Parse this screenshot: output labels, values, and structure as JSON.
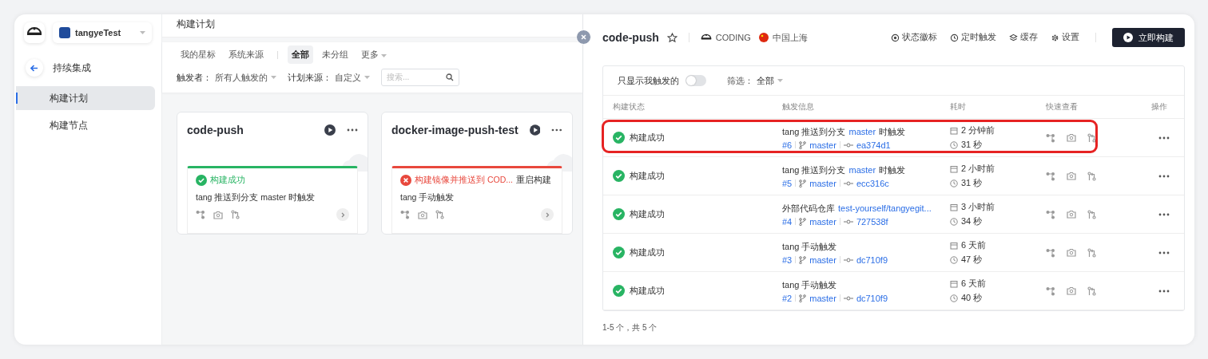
{
  "sidebar": {
    "project": "tangyeTest",
    "back_label": "持续集成",
    "items": [
      {
        "label": "构建计划",
        "selected": true
      },
      {
        "label": "构建节点",
        "selected": false
      }
    ]
  },
  "plans": {
    "title": "构建计划",
    "tabs": [
      {
        "label": "我的星标",
        "selected": false
      },
      {
        "label": "系统来源",
        "selected": false
      },
      {
        "label": "全部",
        "selected": true
      },
      {
        "label": "未分组",
        "selected": false
      },
      {
        "label": "更多",
        "selected": false,
        "kind": "dropdown"
      }
    ],
    "filters": [
      {
        "label": "触发者：",
        "value": "所有人触发的"
      },
      {
        "label": "计划来源：",
        "value": "自定义"
      }
    ],
    "search": {
      "placeholder": "搜索..."
    },
    "cards": [
      {
        "name": "code-push",
        "kind": "success",
        "status_text": "构建成功",
        "trigger": "tang 推送到分支 master 时触发"
      },
      {
        "name": "docker-image-push-test",
        "kind": "failed",
        "status_text": "构建镜像并推送到 COD...",
        "action": "重启构建",
        "trigger": "tang 手动触发"
      }
    ]
  },
  "detail": {
    "title": "code-push",
    "starred": false,
    "org": "CODING",
    "region": "中国上海",
    "actions": [
      "状态徽标",
      "定时触发",
      "缓存",
      "设置"
    ],
    "primary": "立即构建",
    "toggle": {
      "label": "只显示我触发的",
      "on": false
    },
    "filter": {
      "label": "筛选：",
      "value": "全部"
    },
    "columns": [
      "构建状态",
      "触发信息",
      "耗时",
      "快速查看",
      "操作"
    ],
    "rows": [
      {
        "kind": "success",
        "status_text": "构建成功",
        "trigger": {
          "before": "tang 推送到分支 ",
          "link": "master",
          "after": " 时触发"
        },
        "number": "#6",
        "branch": "master",
        "commit": "ea374d1",
        "when": "2 分钟前",
        "duration": "31 秒",
        "highlighted": true
      },
      {
        "kind": "success",
        "status_text": "构建成功",
        "trigger": {
          "before": "tang 推送到分支 ",
          "link": "master",
          "after": " 时触发"
        },
        "number": "#5",
        "branch": "master",
        "commit": "ecc316c",
        "when": "2 小时前",
        "duration": "31 秒",
        "highlighted": false
      },
      {
        "kind": "success",
        "status_text": "构建成功",
        "trigger": {
          "before": "外部代码仓库 ",
          "link": "test-yourself/tangyegit..."
        },
        "number": "#4",
        "branch": "master",
        "commit": "727538f",
        "when": "3 小时前",
        "duration": "34 秒",
        "highlighted": false
      },
      {
        "kind": "success",
        "status_text": "构建成功",
        "trigger": {
          "before": "tang 手动触发"
        },
        "number": "#3",
        "branch": "master",
        "commit": "dc710f9",
        "when": "6 天前",
        "duration": "47 秒",
        "highlighted": false
      },
      {
        "kind": "success",
        "status_text": "构建成功",
        "trigger": {
          "before": "tang 手动触发"
        },
        "number": "#2",
        "branch": "master",
        "commit": "dc710f9",
        "when": "6 天前",
        "duration": "40 秒",
        "highlighted": false
      }
    ],
    "footer": "1-5 个，共 5 个"
  }
}
